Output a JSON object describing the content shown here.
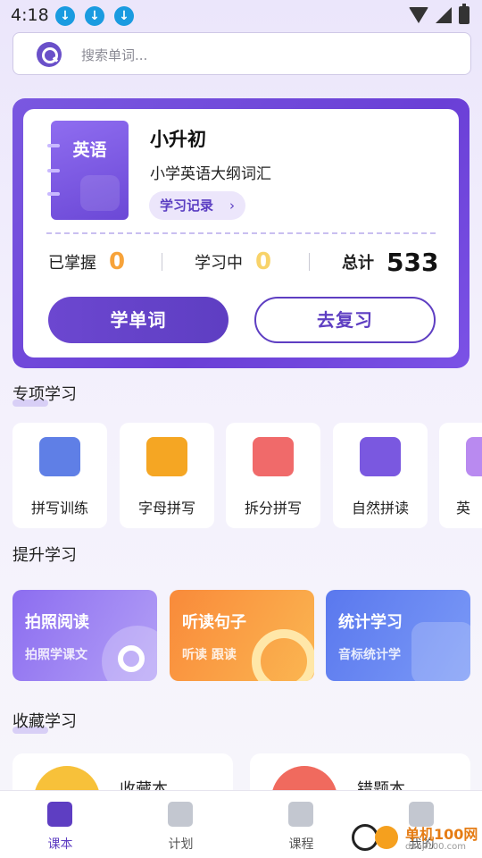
{
  "status_bar": {
    "time": "4:18",
    "download_icons": [
      "download-icon",
      "download-icon",
      "download-icon"
    ]
  },
  "search": {
    "placeholder": "搜索单词..."
  },
  "course": {
    "book_title": "英语",
    "title": "小升初",
    "subtitle": "小学英语大纲词汇",
    "record_label": "学习记录",
    "record_chevron": "›",
    "stats": {
      "mastered_label": "已掌握",
      "mastered_value": "0",
      "learning_label": "学习中",
      "learning_value": "0",
      "total_label": "总计",
      "total_value": "533"
    },
    "learn_button": "学单词",
    "review_button": "去复习"
  },
  "special": {
    "title": "专项学习",
    "items": [
      {
        "label": "拼写训练",
        "icon": "spelling-icon",
        "color": "#5f7fe6"
      },
      {
        "label": "字母拼写",
        "icon": "apple-card-icon",
        "color": "#f5a623"
      },
      {
        "label": "拆分拼写",
        "icon": "split-notebook-icon",
        "color": "#f06a6a"
      },
      {
        "label": "自然拼读",
        "icon": "star-box-icon",
        "color": "#7a58e0"
      },
      {
        "label": "英",
        "icon": "partial-icon",
        "color": "#b98af0"
      }
    ]
  },
  "improve": {
    "title": "提升学习",
    "cards": [
      {
        "title": "拍照阅读",
        "subtitle": "拍照学课文",
        "colors": [
          "#8c6df0",
          "#b3a0f6"
        ]
      },
      {
        "title": "听读句子",
        "subtitle": "听读 跟读",
        "colors": [
          "#f98a3a",
          "#fbb651"
        ]
      },
      {
        "title": "统计学习",
        "subtitle": "音标统计学",
        "colors": [
          "#5a78ee",
          "#7b9af7"
        ]
      }
    ]
  },
  "favorites": {
    "title": "收藏学习",
    "items": [
      {
        "label": "收藏本",
        "color": "#f7c13a"
      },
      {
        "label": "错题本",
        "color": "#f06a5e"
      }
    ]
  },
  "bottom_nav": {
    "items": [
      {
        "label": "课本",
        "icon": "textbook-icon",
        "active": true
      },
      {
        "label": "计划",
        "icon": "plan-list-icon",
        "active": false
      },
      {
        "label": "课程",
        "icon": "video-course-icon",
        "active": false
      },
      {
        "label": "我的",
        "icon": "profile-icon",
        "active": false
      }
    ]
  },
  "watermark": {
    "text": "单机100网",
    "url": "danji100.com"
  },
  "colors": {
    "accent": "#5e3ec2",
    "orange_zero": "#f7a33a",
    "yellow_zero": "#f8d36a"
  }
}
